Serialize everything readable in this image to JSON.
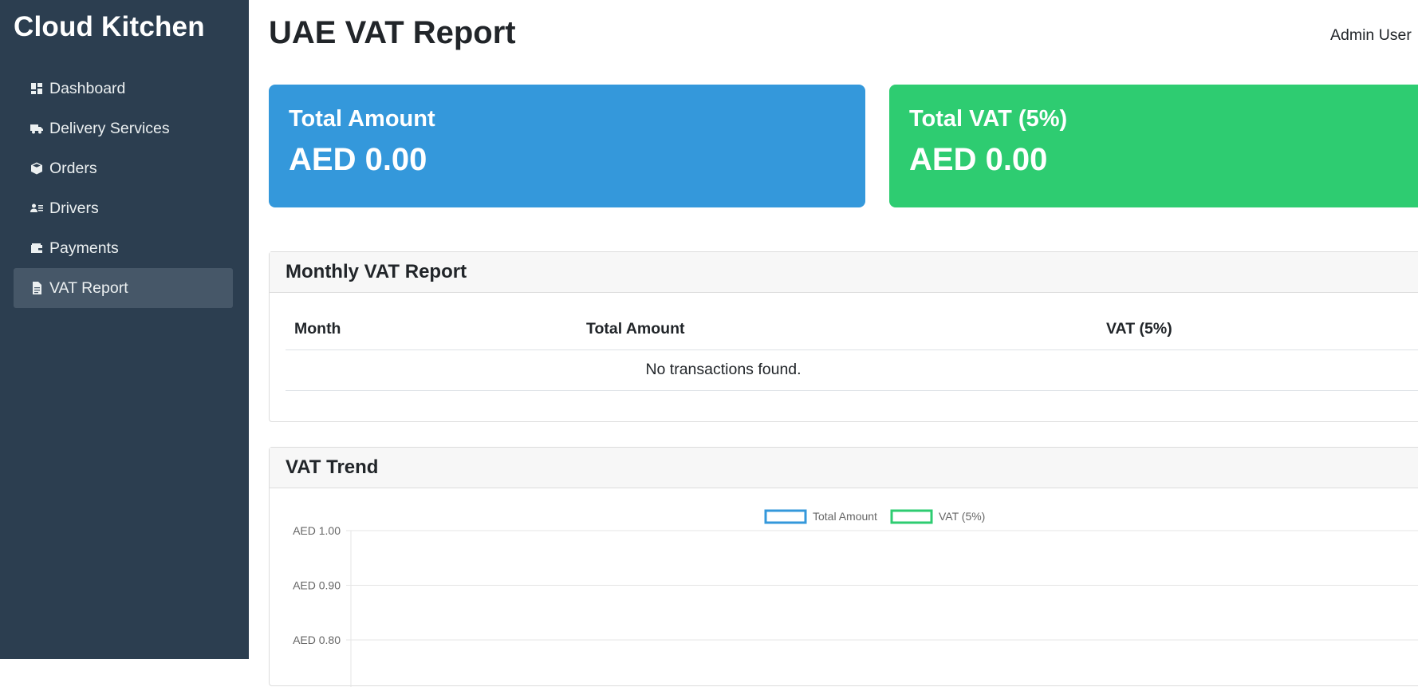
{
  "sidebar": {
    "brand": "Cloud Kitchen",
    "items": [
      {
        "label": "Dashboard",
        "icon": "dashboard-icon",
        "active": false
      },
      {
        "label": "Delivery Services",
        "icon": "truck-icon",
        "active": false
      },
      {
        "label": "Orders",
        "icon": "box-icon",
        "active": false
      },
      {
        "label": "Drivers",
        "icon": "id-card-icon",
        "active": false
      },
      {
        "label": "Payments",
        "icon": "wallet-icon",
        "active": false
      },
      {
        "label": "VAT Report",
        "icon": "document-icon",
        "active": true
      }
    ]
  },
  "header": {
    "title": "UAE VAT Report",
    "user": "Admin User"
  },
  "summary": {
    "total_amount": {
      "label": "Total Amount",
      "value": "AED 0.00",
      "color": "#3498db"
    },
    "total_vat": {
      "label": "Total VAT (5%)",
      "value": "AED 0.00",
      "color": "#2ecc71"
    }
  },
  "monthly_report": {
    "title": "Monthly VAT Report",
    "columns": [
      "Month",
      "Total Amount",
      "VAT (5%)"
    ],
    "empty_message": "No transactions found."
  },
  "vat_trend": {
    "title": "VAT Trend"
  },
  "chart_data": {
    "type": "line",
    "categories": [],
    "series": [
      {
        "name": "Total Amount",
        "values": [],
        "color": "#3498db"
      },
      {
        "name": "VAT (5%)",
        "values": [],
        "color": "#2ecc71"
      }
    ],
    "y_ticks": [
      "AED 1.00",
      "AED 0.90",
      "AED 0.80"
    ],
    "ylim": [
      0,
      1
    ],
    "legend": "top-center",
    "grid": true
  }
}
